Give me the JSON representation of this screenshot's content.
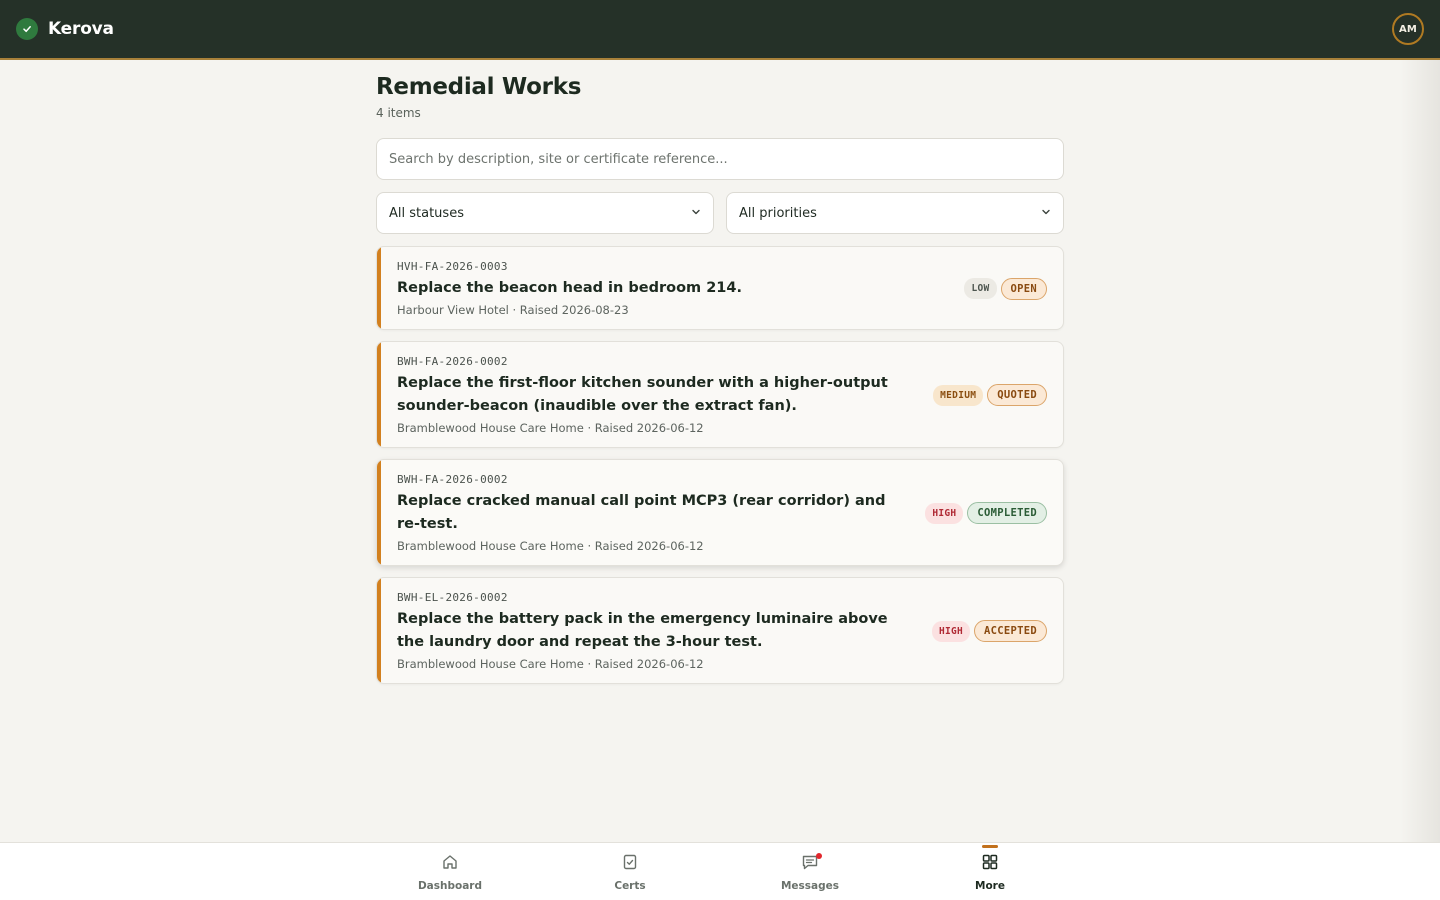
{
  "app": {
    "name": "Kerova",
    "user_initials": "AM"
  },
  "page": {
    "title": "Remedial Works",
    "count": "4 items"
  },
  "search": {
    "placeholder": "Search by description, site or certificate reference..."
  },
  "filters": {
    "status": "All statuses",
    "priority": "All priorities"
  },
  "items": [
    {
      "ref": "HVH-FA-2026-0003",
      "description": "Replace the beacon head in bedroom 214.",
      "meta": "Harbour View Hotel · Raised 2026-08-23",
      "priority": "LOW",
      "status": "OPEN"
    },
    {
      "ref": "BWH-FA-2026-0002",
      "description": "Replace the first-floor kitchen sounder with a higher-output sounder-beacon (inaudible over the extract fan).",
      "meta": "Bramblewood House Care Home · Raised 2026-06-12",
      "priority": "MEDIUM",
      "status": "QUOTED"
    },
    {
      "ref": "BWH-FA-2026-0002",
      "description": "Replace cracked manual call point MCP3 (rear corridor) and re-test.",
      "meta": "Bramblewood House Care Home · Raised 2026-06-12",
      "priority": "HIGH",
      "status": "COMPLETED"
    },
    {
      "ref": "BWH-EL-2026-0002",
      "description": "Replace the battery pack in the emergency luminaire above the laundry door and repeat the 3-hour test.",
      "meta": "Bramblewood House Care Home · Raised 2026-06-12",
      "priority": "HIGH",
      "status": "ACCEPTED"
    }
  ],
  "nav": [
    {
      "label": "Dashboard",
      "icon": "home-icon"
    },
    {
      "label": "Certs",
      "icon": "certificate-icon"
    },
    {
      "label": "Messages",
      "icon": "message-icon"
    },
    {
      "label": "More",
      "icon": "grid-icon"
    }
  ],
  "colors": {
    "topbar": "#253128",
    "accent": "#d2801f",
    "brand_check": "#2f7a3e",
    "notification_dot": "#e2262c"
  }
}
